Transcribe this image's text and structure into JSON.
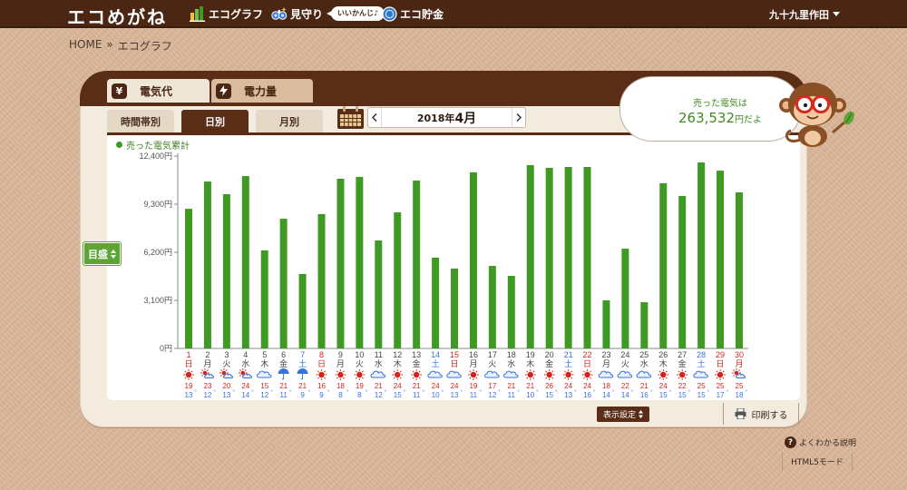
{
  "header": {
    "logo": "エコめがね",
    "nav": [
      {
        "label": "エコグラフ",
        "icon": "bar-chart-icon"
      },
      {
        "label": "見守り",
        "icon": "binoculars-icon",
        "badge": "いいかんじ♪"
      },
      {
        "label": "エコ貯金",
        "icon": "coin-icon"
      }
    ],
    "user_name": "九十九里作田",
    "user_menu_icon": "chevron-down-icon"
  },
  "breadcrumb": {
    "home": "HOME",
    "separator": "»",
    "current": "エコグラフ"
  },
  "main_tabs": [
    {
      "label": "電気代",
      "icon": "yen-icon",
      "active": true
    },
    {
      "label": "電力量",
      "icon": "lightning-icon",
      "active": false
    }
  ],
  "period_tabs": [
    {
      "label": "時間帯別",
      "active": false
    },
    {
      "label": "日別",
      "active": true
    },
    {
      "label": "月別",
      "active": false
    }
  ],
  "date_nav": {
    "year": "2018年",
    "month": "4月",
    "prev_icon": "chevron-left-icon",
    "next_icon": "chevron-right-icon",
    "calendar_icon": "calendar-icon"
  },
  "bubble": {
    "line1": "売った電気は",
    "amount": "263,532",
    "suffix": "円だよ"
  },
  "scale_button": {
    "label": "目盛",
    "icon": "up-down-arrows-icon"
  },
  "footer_controls": {
    "settings_label": "表示設定",
    "print_label": "印刷する",
    "print_icon": "printer-icon"
  },
  "help": {
    "label": "よくわかる説明",
    "icon": "question-icon"
  },
  "mode_button": {
    "label": "HTML5モード"
  },
  "colors": {
    "header": "#4a2613",
    "accent_brown": "#5a2d17",
    "bar": "#3f9a24",
    "scale_button": "#5aa535",
    "day_sunday": "#d3241c",
    "day_holiday": "#d3241c",
    "day_saturday": "#3a72de",
    "day_weekday": "#444444",
    "temp_high": "#d3241c",
    "temp_low": "#3a72de",
    "sun": "#d3241c",
    "cloud": "#3a72de"
  },
  "chart_data": {
    "type": "bar",
    "categories": [
      "1",
      "2",
      "3",
      "4",
      "5",
      "6",
      "7",
      "8",
      "9",
      "10",
      "11",
      "12",
      "13",
      "14",
      "15",
      "16",
      "17",
      "18",
      "19",
      "20",
      "21",
      "22",
      "23",
      "24",
      "25",
      "26",
      "27",
      "28",
      "29",
      "30"
    ],
    "weekdays": [
      "日",
      "月",
      "火",
      "水",
      "木",
      "金",
      "土",
      "日",
      "月",
      "火",
      "水",
      "木",
      "金",
      "土",
      "日",
      "月",
      "火",
      "水",
      "木",
      "金",
      "土",
      "日",
      "月",
      "火",
      "水",
      "木",
      "金",
      "土",
      "日",
      "月"
    ],
    "day_kinds": [
      "sunday",
      "weekday",
      "weekday",
      "weekday",
      "weekday",
      "weekday",
      "saturday",
      "sunday",
      "weekday",
      "weekday",
      "weekday",
      "weekday",
      "weekday",
      "saturday",
      "sunday",
      "weekday",
      "weekday",
      "weekday",
      "weekday",
      "weekday",
      "saturday",
      "sunday",
      "weekday",
      "weekday",
      "weekday",
      "weekday",
      "weekday",
      "saturday",
      "sunday",
      "holiday"
    ],
    "series": [
      {
        "name": "売った電気累計",
        "values": [
          9000,
          10760,
          9940,
          11110,
          6320,
          8360,
          4800,
          8660,
          10940,
          11060,
          6960,
          8770,
          10820,
          5850,
          5150,
          11350,
          5320,
          4680,
          11820,
          11640,
          11700,
          11700,
          3100,
          6430,
          2980,
          10650,
          9830,
          11990,
          11460,
          10060
        ]
      }
    ],
    "y_ticks": [
      0,
      3100,
      6200,
      9300,
      12400
    ],
    "y_tick_labels": [
      "0円",
      "3,100円",
      "6,200円",
      "9,300円",
      "12,400円"
    ],
    "ylim": [
      0,
      12400
    ],
    "weather": [
      "sunny-icon",
      "sunny-cloudy-icon",
      "sunny-cloudy-icon",
      "sunny-cloudy-icon",
      "cloudy-icon",
      "rainy-icon",
      "rainy-icon",
      "sunny-icon",
      "sunny-icon",
      "sunny-icon",
      "cloudy-icon",
      "sunny-icon",
      "sunny-icon",
      "cloudy-icon",
      "cloudy-icon",
      "sunny-icon",
      "cloudy-icon",
      "cloudy-icon",
      "sunny-icon",
      "sunny-icon",
      "sunny-icon",
      "sunny-icon",
      "cloudy-icon",
      "cloudy-icon",
      "cloudy-icon",
      "sunny-icon",
      "sunny-icon",
      "cloudy-icon",
      "sunny-icon",
      "sunny-cloudy-icon"
    ],
    "temp_high": [
      19,
      23,
      20,
      24,
      15,
      21,
      21,
      16,
      18,
      19,
      21,
      24,
      21,
      24,
      24,
      19,
      17,
      21,
      21,
      26,
      24,
      24,
      18,
      22,
      21,
      24,
      22,
      25,
      25,
      25
    ],
    "temp_low": [
      13,
      12,
      13,
      14,
      12,
      11,
      9,
      9,
      8,
      8,
      12,
      15,
      11,
      10,
      13,
      11,
      12,
      11,
      10,
      15,
      13,
      16,
      14,
      14,
      16,
      15,
      15,
      15,
      17,
      18
    ],
    "temp_unit": "°",
    "legend_position": "top-left",
    "grid": false
  }
}
